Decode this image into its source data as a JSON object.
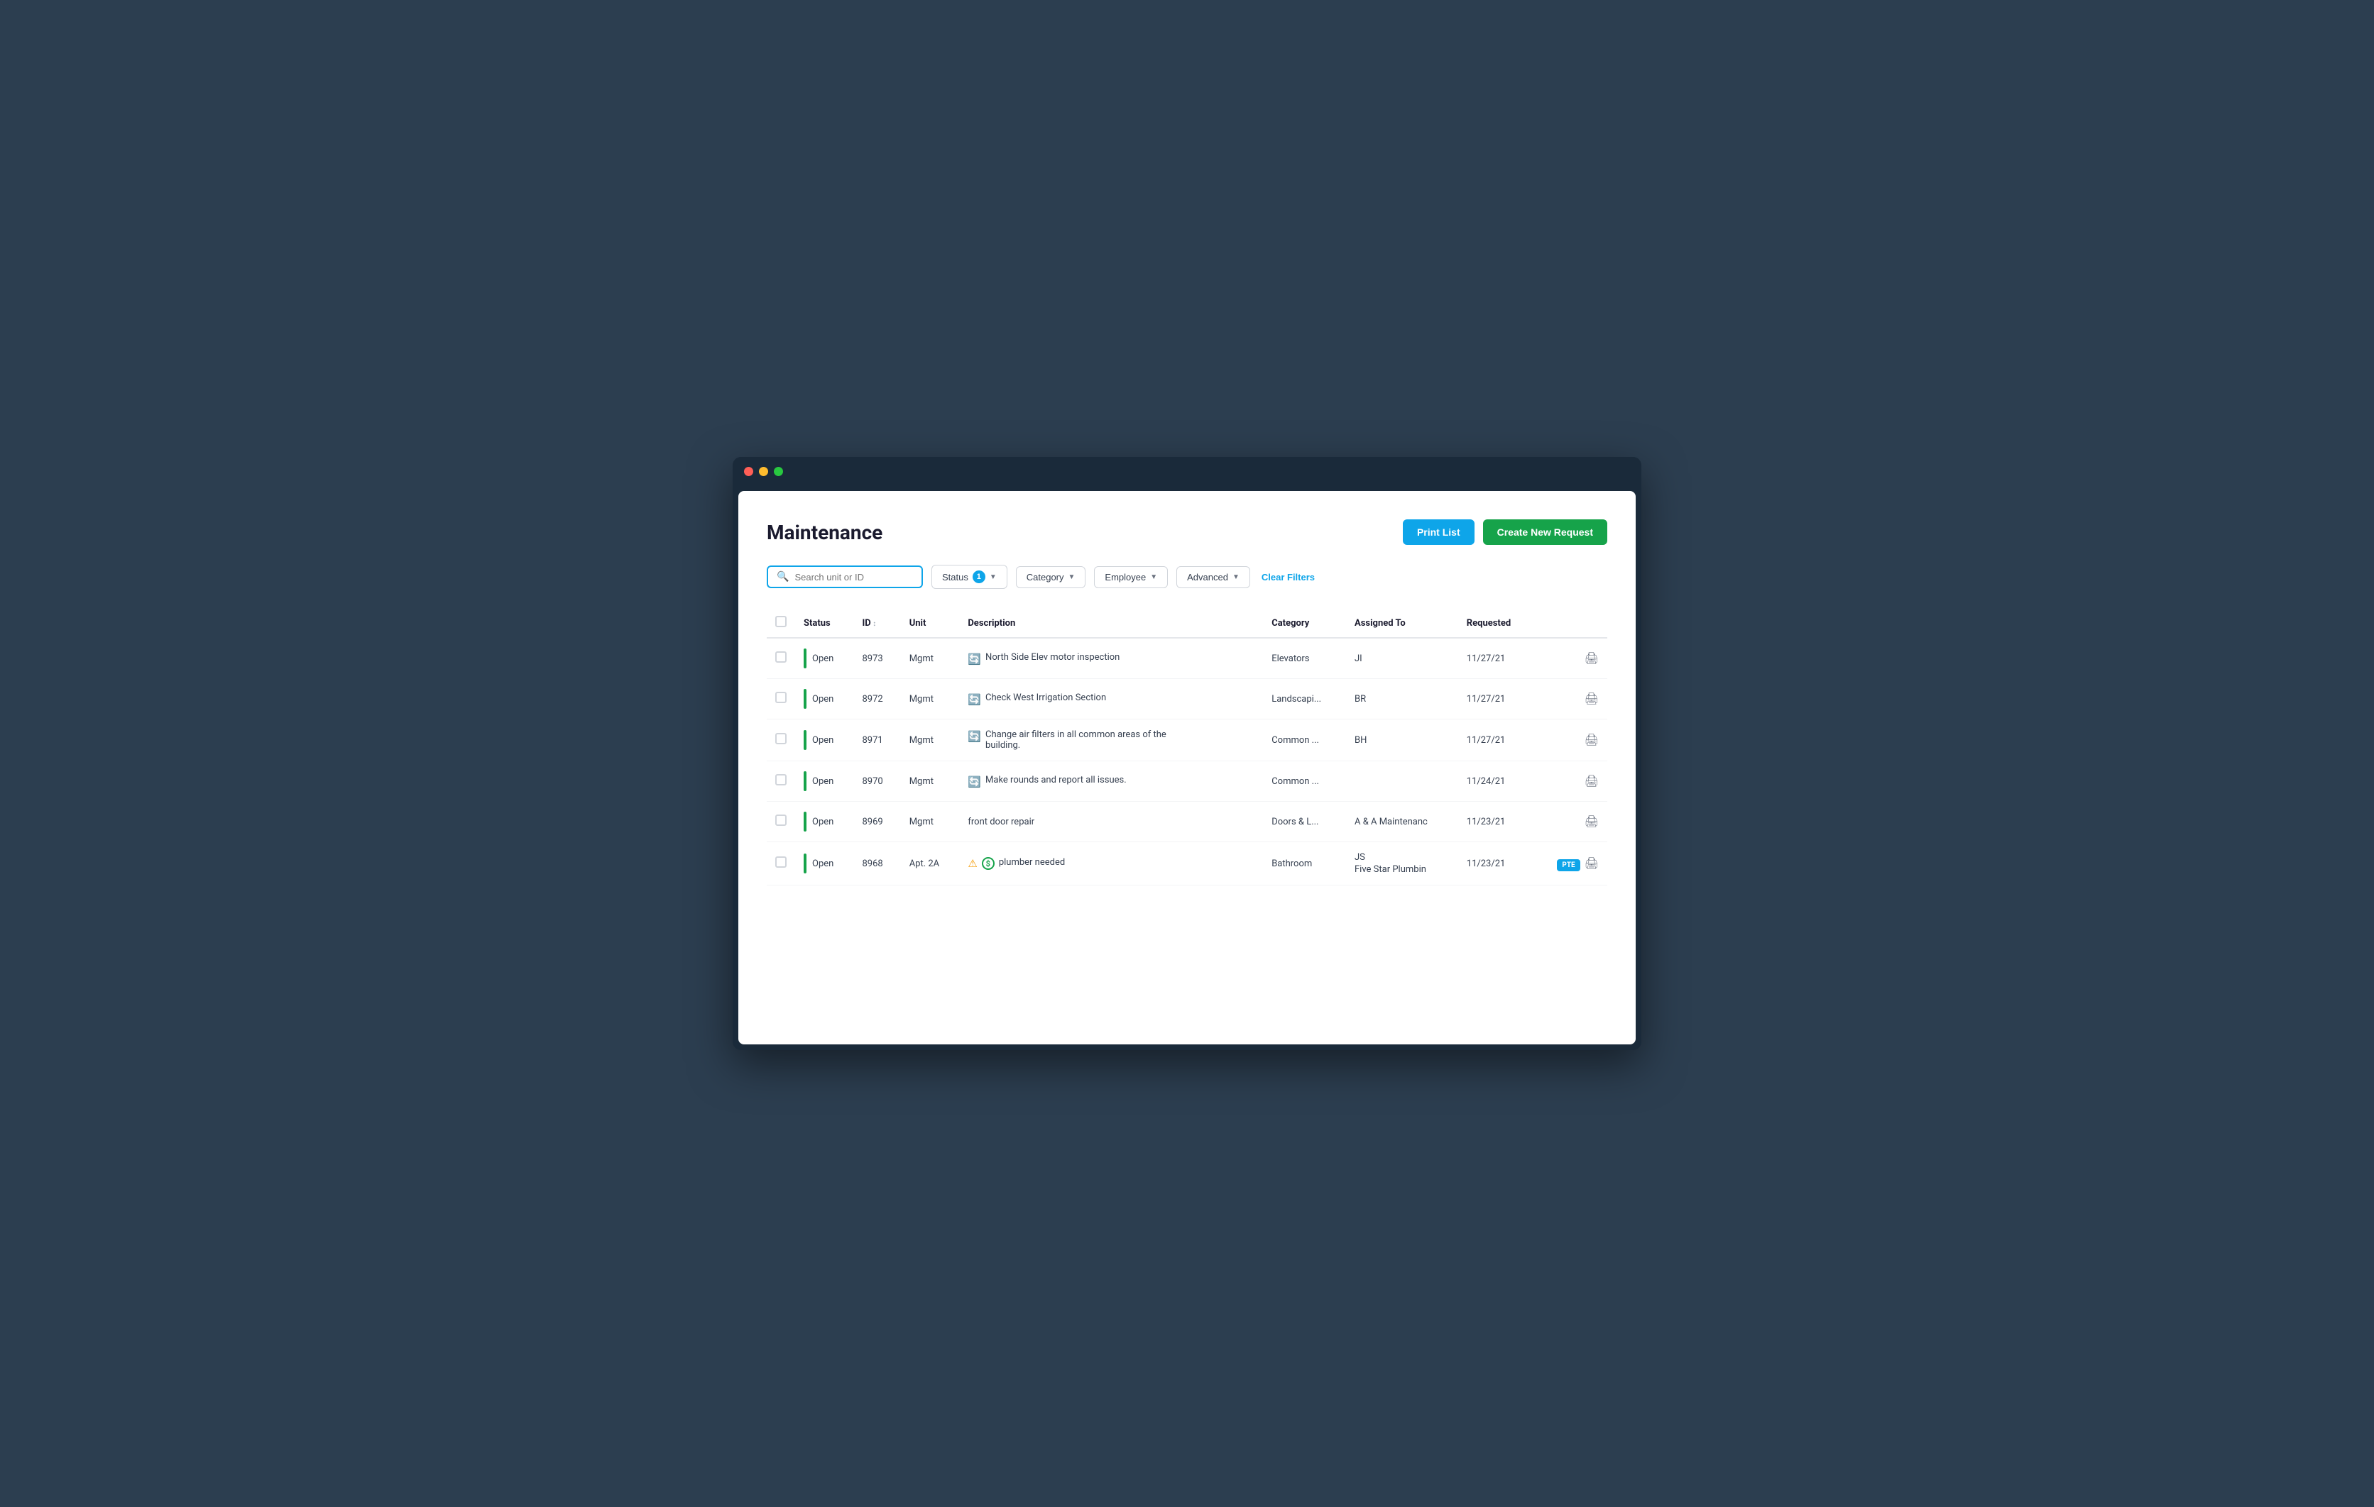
{
  "window": {
    "title": "Maintenance"
  },
  "header": {
    "title": "Maintenance",
    "print_label": "Print List",
    "create_label": "Create New Request"
  },
  "filters": {
    "search_placeholder": "Search unit or ID",
    "status_label": "Status",
    "status_badge": "1",
    "category_label": "Category",
    "employee_label": "Employee",
    "advanced_label": "Advanced",
    "clear_label": "Clear Filters"
  },
  "table": {
    "columns": [
      "",
      "Status",
      "ID",
      "Unit",
      "Description",
      "Category",
      "Assigned To",
      "Requested",
      ""
    ],
    "rows": [
      {
        "id": 1,
        "status": "Open",
        "record_id": "8973",
        "unit": "Mgmt",
        "description": "North Side Elev motor inspection",
        "has_refresh": true,
        "category": "Elevators",
        "assigned_to": "JI",
        "requested": "11/27/21",
        "has_pte": false,
        "has_warn": false,
        "has_dollar": false
      },
      {
        "id": 2,
        "status": "Open",
        "record_id": "8972",
        "unit": "Mgmt",
        "description": "Check West Irrigation Section",
        "has_refresh": true,
        "category": "Landscapi...",
        "assigned_to": "BR",
        "requested": "11/27/21",
        "has_pte": false,
        "has_warn": false,
        "has_dollar": false
      },
      {
        "id": 3,
        "status": "Open",
        "record_id": "8971",
        "unit": "Mgmt",
        "description": "Change air filters in all common areas of the building.",
        "has_refresh": true,
        "category": "Common ...",
        "assigned_to": "BH",
        "requested": "11/27/21",
        "has_pte": false,
        "has_warn": false,
        "has_dollar": false
      },
      {
        "id": 4,
        "status": "Open",
        "record_id": "8970",
        "unit": "Mgmt",
        "description": "Make rounds and report all issues.",
        "has_refresh": true,
        "category": "Common ...",
        "assigned_to": "",
        "requested": "11/24/21",
        "has_pte": false,
        "has_warn": false,
        "has_dollar": false
      },
      {
        "id": 5,
        "status": "Open",
        "record_id": "8969",
        "unit": "Mgmt",
        "description": "front door repair",
        "has_refresh": false,
        "category": "Doors & L...",
        "assigned_to": "A & A Maintenanc",
        "requested": "11/23/21",
        "has_pte": false,
        "has_warn": false,
        "has_dollar": false
      },
      {
        "id": 6,
        "status": "Open",
        "record_id": "8968",
        "unit": "Apt. 2A",
        "description": "plumber needed",
        "has_refresh": false,
        "category": "Bathroom",
        "assigned_to": "JS",
        "assigned_to2": "Five Star Plumbin",
        "requested": "11/23/21",
        "has_pte": true,
        "has_warn": true,
        "has_dollar": true
      }
    ]
  }
}
